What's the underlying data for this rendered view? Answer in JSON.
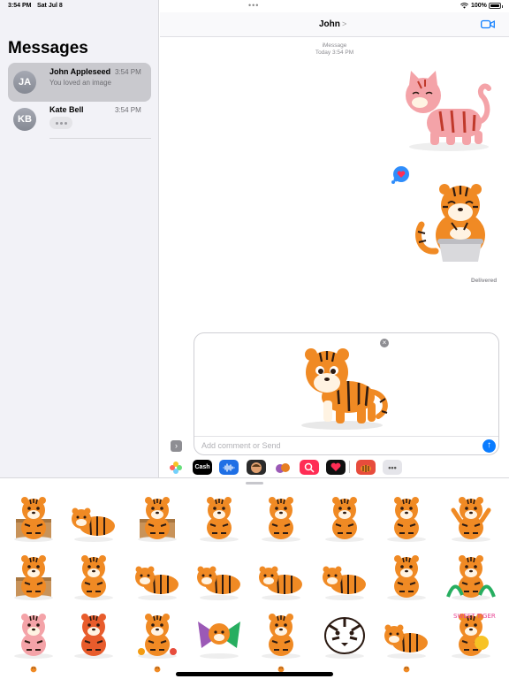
{
  "status_bar": {
    "time": "3:54 PM",
    "date": "Sat Jul 8",
    "dots": "•••",
    "battery": "100%"
  },
  "sidebar": {
    "title": "Messages",
    "conversations": [
      {
        "initials": "JA",
        "name": "John Appleseed",
        "time": "3:54 PM",
        "preview": "You loved an image",
        "selected": true
      },
      {
        "initials": "KB",
        "name": "Kate Bell",
        "time": "3:54 PM",
        "preview": "",
        "typing": true
      }
    ]
  },
  "conversation": {
    "contact_name": "John",
    "chevron": ">",
    "service_label": "iMessage",
    "timestamp": "Today 3:54 PM",
    "delivered": "Delivered"
  },
  "compose": {
    "placeholder": "Add comment or Send",
    "close": "×",
    "send": "↑",
    "expand": "›"
  },
  "app_bar": {
    "apps": [
      "photos-app",
      "apple-cash-app",
      "audio-message-app",
      "memoji-app",
      "sticker-app",
      "search-images-app",
      "heart-stickers-app",
      "tiger-stickers-app",
      "more-apps"
    ],
    "cash_label": "Cash",
    "more_label": "•••"
  },
  "sticker_drawer": {
    "rows": 4,
    "columns": 8,
    "stickers": [
      "tiger-sitting-box",
      "tiger-lying",
      "tiger-in-box",
      "tiger-chubby",
      "tiger-standing",
      "tiger-waving",
      "tiger-curled",
      "tiger-arms-up",
      "tiger-cardboard-box",
      "tiger-front",
      "tiger-leaping",
      "tiger-sleeping",
      "tiger-walking",
      "tiger-prowling",
      "tiger-sitting-angry",
      "tiger-in-leaves",
      "tiger-pink",
      "tiger-red-sitting",
      "tiger-with-flowers",
      "tiger-colorful-wings",
      "tiger-baby",
      "tiger-face",
      "tiger-crouched",
      "tiger-sweet-text"
    ],
    "sweet_text": "SWEET TIGER!",
    "colors": {
      "orange": "#f08a24",
      "stripe": "#2b1a12",
      "cream": "#fff3e2",
      "pink": "#f4a3a8"
    }
  },
  "colors": {
    "accent": "#0a7cff",
    "sidebar_bg": "#f2f2f7",
    "selected_row": "#c9c9ce",
    "heart": "#ff2d55"
  }
}
